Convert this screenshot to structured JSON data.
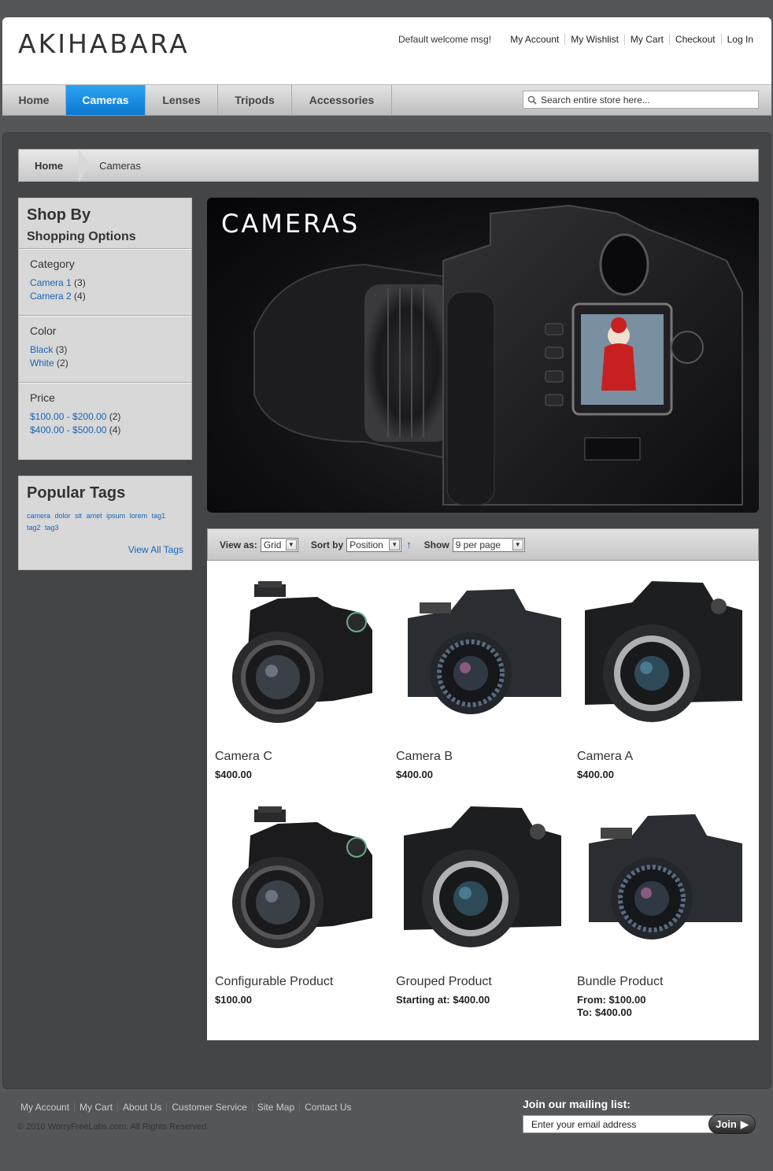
{
  "header": {
    "logo": "AKIHABARA",
    "welcome": "Default welcome msg!",
    "links": [
      "My Account",
      "My Wishlist",
      "My Cart",
      "Checkout",
      "Log In"
    ]
  },
  "nav": {
    "items": [
      {
        "label": "Home",
        "active": false
      },
      {
        "label": "Cameras",
        "active": true
      },
      {
        "label": "Lenses",
        "active": false
      },
      {
        "label": "Tripods",
        "active": false
      },
      {
        "label": "Accessories",
        "active": false
      }
    ],
    "search_placeholder": "Search entire store here..."
  },
  "breadcrumb": {
    "home": "Home",
    "current": "Cameras"
  },
  "sidebar": {
    "title": "Shop By",
    "subtitle": "Shopping Options",
    "filters": [
      {
        "title": "Category",
        "items": [
          {
            "label": "Camera 1",
            "count": "(3)"
          },
          {
            "label": "Camera 2",
            "count": "(4)"
          }
        ]
      },
      {
        "title": "Color",
        "items": [
          {
            "label": "Black",
            "count": "(3)"
          },
          {
            "label": "White",
            "count": "(2)"
          }
        ]
      },
      {
        "title": "Price",
        "items": [
          {
            "label": "$100.00 - $200.00",
            "count": "(2)"
          },
          {
            "label": "$400.00 - $500.00",
            "count": "(4)"
          }
        ]
      }
    ],
    "tags_title": "Popular Tags",
    "tags": [
      "camera",
      "dolor",
      "sit",
      "amet",
      "ipsum",
      "lorem",
      "tag1",
      "tag2",
      "tag3"
    ],
    "view_all": "View All Tags"
  },
  "banner": {
    "title": "CAMERAS"
  },
  "toolbar": {
    "view_as_label": "View as:",
    "view_as_value": "Grid",
    "sort_by_label": "Sort by",
    "sort_by_value": "Position",
    "show_label": "Show",
    "show_value": "9 per page"
  },
  "products": [
    {
      "name": "Camera C",
      "price": "$400.00",
      "price2": ""
    },
    {
      "name": "Camera B",
      "price": "$400.00",
      "price2": ""
    },
    {
      "name": "Camera A",
      "price": "$400.00",
      "price2": ""
    },
    {
      "name": "Configurable Product",
      "price": "$100.00",
      "price2": ""
    },
    {
      "name": "Grouped Product",
      "price": "Starting at: $400.00",
      "price2": ""
    },
    {
      "name": "Bundle Product",
      "price": "From: $100.00",
      "price2": "To: $400.00"
    }
  ],
  "footer": {
    "links": [
      "My Account",
      "My Cart",
      "About Us",
      "Customer Service",
      "Site Map",
      "Contact Us"
    ],
    "copyright": "© 2010 WorryFreeLabs.com. All Rights Reserved.",
    "mailing_title": "Join our mailing list:",
    "mailing_placeholder": "Enter your email address",
    "join_label": "Join"
  }
}
